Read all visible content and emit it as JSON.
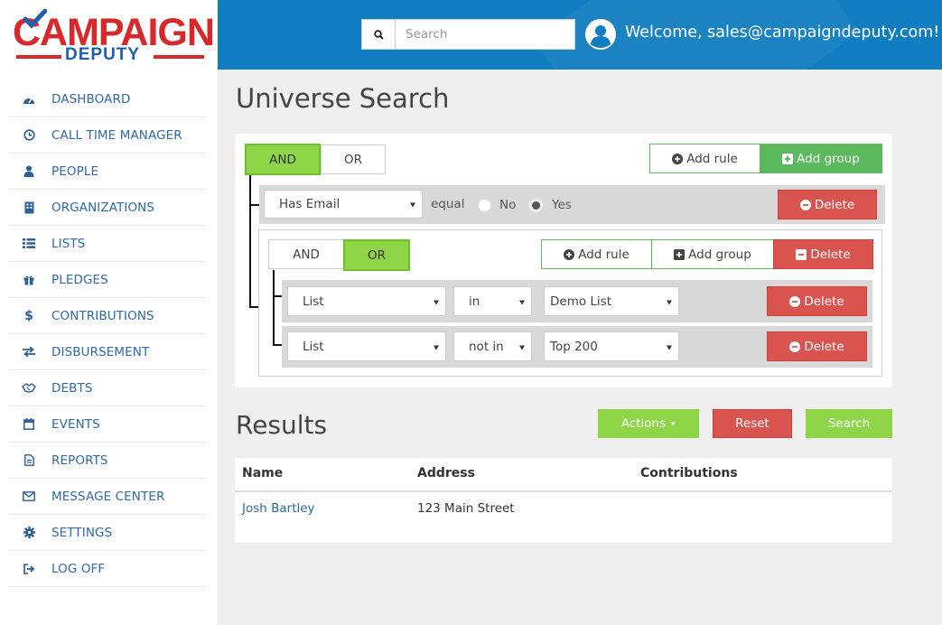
{
  "logo": {
    "top": "CAMPAIGN",
    "bottom": "DEPUTY"
  },
  "sidebar": {
    "items": [
      {
        "label": "DASHBOARD",
        "icon": "dashboard-icon"
      },
      {
        "label": "CALL TIME MANAGER",
        "icon": "clock-icon"
      },
      {
        "label": "PEOPLE",
        "icon": "user-icon"
      },
      {
        "label": "ORGANIZATIONS",
        "icon": "building-icon"
      },
      {
        "label": "LISTS",
        "icon": "list-icon"
      },
      {
        "label": "PLEDGES",
        "icon": "gift-icon"
      },
      {
        "label": "CONTRIBUTIONS",
        "icon": "dollar-icon"
      },
      {
        "label": "DISBURSEMENT",
        "icon": "exchange-icon"
      },
      {
        "label": "DEBTS",
        "icon": "handshake-icon"
      },
      {
        "label": "EVENTS",
        "icon": "calendar-icon"
      },
      {
        "label": "REPORTS",
        "icon": "file-icon"
      },
      {
        "label": "MESSAGE CENTER",
        "icon": "envelope-icon"
      },
      {
        "label": "SETTINGS",
        "icon": "gear-icon"
      },
      {
        "label": "LOG OFF",
        "icon": "sign-out-icon"
      }
    ]
  },
  "header": {
    "search_placeholder": "Search",
    "welcome": "Welcome, sales@campaigndeputy.com!",
    "colors": {
      "bg": "#0f7dbf"
    }
  },
  "page": {
    "title": "Universe Search"
  },
  "builder": {
    "root": {
      "and_label": "AND",
      "or_label": "OR",
      "add_rule_label": "Add rule",
      "add_group_label": "Add group",
      "rule": {
        "field": "Has Email",
        "operator": "equal",
        "options": [
          "No",
          "Yes"
        ],
        "selected": "Yes",
        "delete_label": "Delete"
      }
    },
    "group": {
      "and_label": "AND",
      "or_label": "OR",
      "add_rule_label": "Add rule",
      "add_group_label": "Add group",
      "delete_label": "Delete",
      "rules": [
        {
          "field": "List",
          "operator": "in",
          "value": "Demo List",
          "delete_label": "Delete"
        },
        {
          "field": "List",
          "operator": "not in",
          "value": "Top 200",
          "delete_label": "Delete"
        }
      ]
    }
  },
  "results": {
    "title": "Results",
    "actions_label": "Actions",
    "reset_label": "Reset",
    "search_label": "Search",
    "columns": [
      "Name",
      "Address",
      "Contributions"
    ],
    "rows": [
      {
        "name": "Josh Bartley",
        "address": "123 Main Street",
        "contributions": ""
      }
    ]
  }
}
